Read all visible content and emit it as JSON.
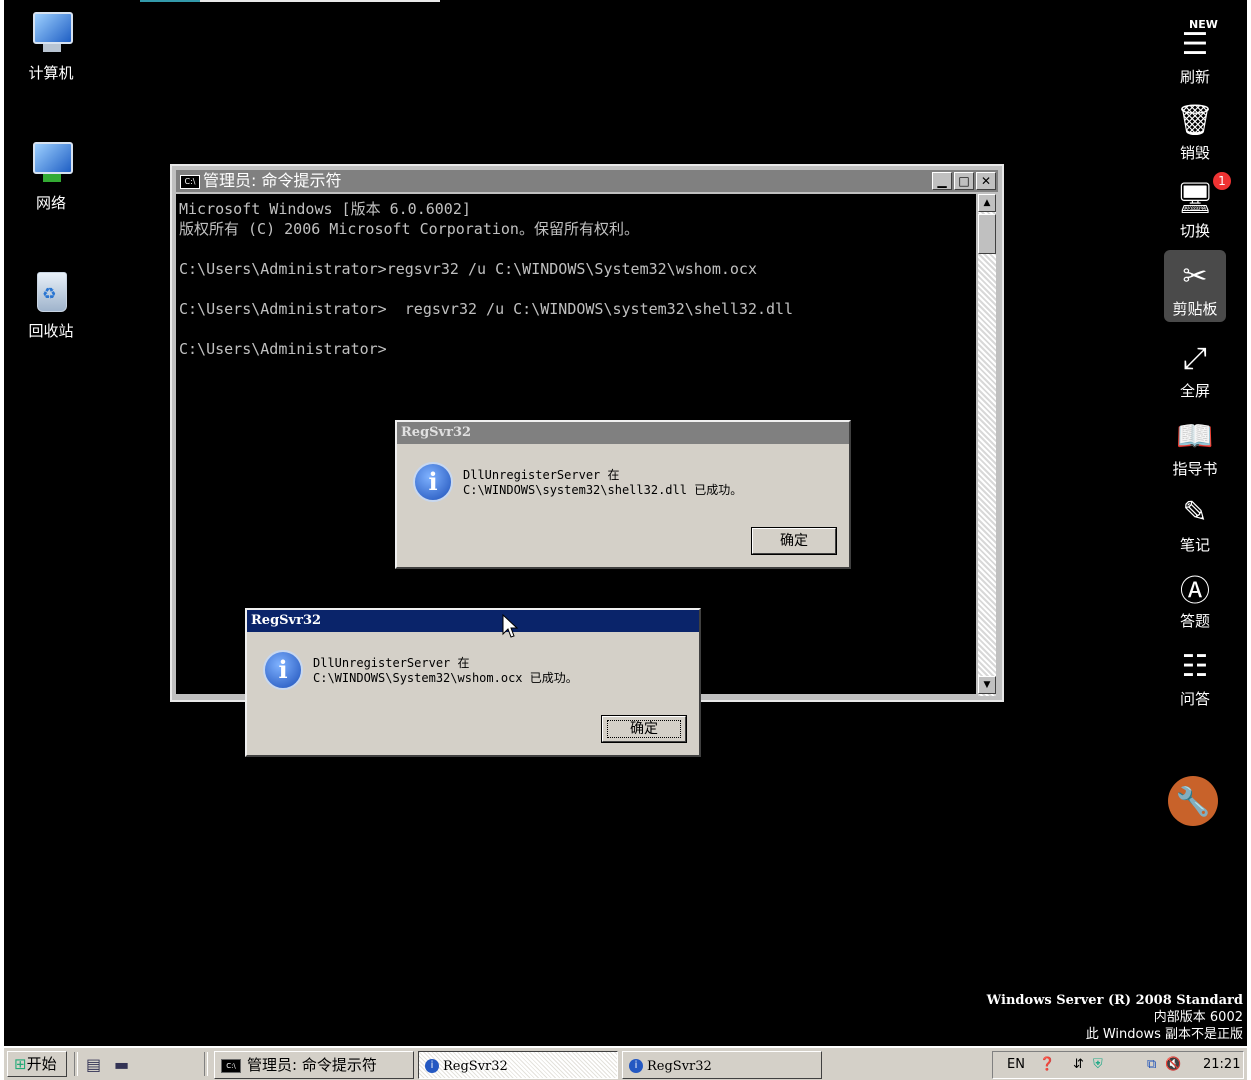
{
  "desktop": {
    "icons": [
      {
        "label": "计算机"
      },
      {
        "label": "网络"
      },
      {
        "label": "回收站"
      }
    ],
    "watermark": {
      "line1": "Windows Server (R) 2008 Standard",
      "line2": "内部版本 6002",
      "line3": "此 Windows 副本不是正版"
    }
  },
  "toolbar": {
    "items": [
      {
        "label": "刷新",
        "icon": "refresh-new-icon",
        "tag": "NEW"
      },
      {
        "label": "销毁",
        "icon": "trash-icon"
      },
      {
        "label": "切换",
        "icon": "switch-screen-icon",
        "badge": "1"
      },
      {
        "label": "剪贴板",
        "icon": "scissors-icon"
      },
      {
        "label": "全屏",
        "icon": "fullscreen-icon"
      },
      {
        "label": "指导书",
        "icon": "book-icon"
      },
      {
        "label": "笔记",
        "icon": "pencil-icon"
      },
      {
        "label": "答题",
        "icon": "answer-icon"
      },
      {
        "label": "问答",
        "icon": "qa-icon"
      }
    ],
    "tools_icon": "wrench-icon"
  },
  "cmd": {
    "title": "管理员: 命令提示符",
    "icon_text": "C:\\",
    "lines": [
      "Microsoft Windows [版本 6.0.6002]",
      "版权所有 (C) 2006 Microsoft Corporation。保留所有权利。",
      "",
      "C:\\Users\\Administrator>regsvr32 /u C:\\WINDOWS\\System32\\wshom.ocx",
      "",
      "C:\\Users\\Administrator>  regsvr32 /u C:\\WINDOWS\\system32\\shell32.dll",
      "",
      "C:\\Users\\Administrator>"
    ]
  },
  "dialog_back": {
    "title": "RegSvr32",
    "line1": "DllUnregisterServer 在",
    "line2": "C:\\WINDOWS\\system32\\shell32.dll 已成功。",
    "ok": "确定"
  },
  "dialog_front": {
    "title": "RegSvr32",
    "line1": "DllUnregisterServer 在",
    "line2": "C:\\WINDOWS\\System32\\wshom.ocx 已成功。",
    "ok": "确定"
  },
  "taskbar": {
    "start": "开始",
    "buttons": [
      {
        "label": "管理员: 命令提示符"
      },
      {
        "label": "RegSvr32"
      },
      {
        "label": "RegSvr32"
      }
    ],
    "tray": {
      "lang": "EN",
      "clock": "21:21"
    }
  }
}
